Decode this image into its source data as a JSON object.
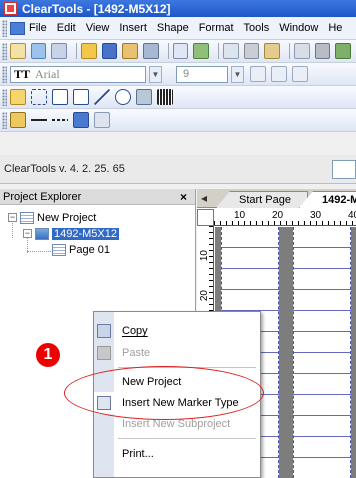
{
  "window": {
    "title": "ClearTools - [1492-M5X12]"
  },
  "menubar": {
    "items": [
      "File",
      "Edit",
      "View",
      "Insert",
      "Shape",
      "Format",
      "Tools",
      "Window",
      "He"
    ]
  },
  "format_toolbar": {
    "font_name": "Arial",
    "font_icon": "TT",
    "font_size": "9"
  },
  "version": {
    "text": "ClearTools v. 4. 2. 25. 65"
  },
  "explorer": {
    "title": "Project Explorer",
    "close_glyph": "×",
    "tree": [
      {
        "label": "New Project",
        "expander": "−"
      },
      {
        "label": "1492-M5X12",
        "expander": "−"
      },
      {
        "label": "Page 01"
      }
    ]
  },
  "tabs": {
    "nav": "◂",
    "items": [
      "Start Page",
      "1492-M"
    ]
  },
  "ruler": {
    "h_labels": [
      "10",
      "20",
      "30",
      "40"
    ],
    "v_labels": [
      "10",
      "20"
    ]
  },
  "context_menu": {
    "items": [
      {
        "label": "Copy",
        "underline": "C",
        "disabled": false
      },
      {
        "label": "Paste",
        "underline": "P",
        "disabled": true
      },
      {
        "label": "New Project",
        "underline": "N",
        "disabled": false
      },
      {
        "label": "Insert New Marker Type",
        "underline": "k",
        "disabled": false
      },
      {
        "label": "Insert New Subproject",
        "underline": "S",
        "disabled": true
      },
      {
        "label": "Print...",
        "underline": "i",
        "disabled": false
      }
    ]
  },
  "annotation": {
    "step": "1"
  },
  "colors": {
    "titlebar": "#2a60d0",
    "selection": "#316ac5",
    "callout": "#d22222",
    "badge": "#e00000"
  }
}
